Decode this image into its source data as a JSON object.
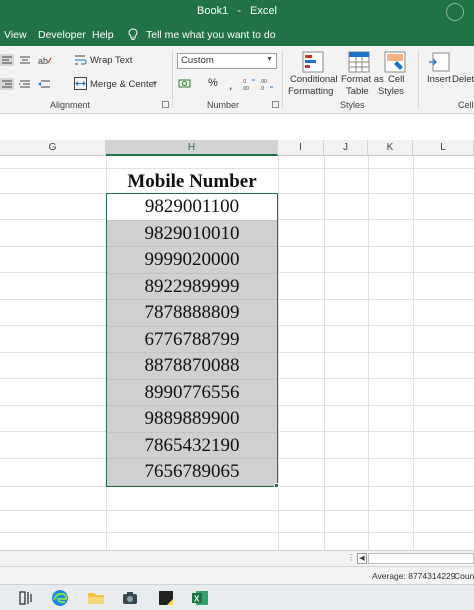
{
  "window": {
    "workbook": "Book1",
    "separator": "-",
    "app": "Excel"
  },
  "ribbon_tabs": {
    "view": "View",
    "developer": "Developer",
    "help": "Help",
    "tell_me": "Tell me what you want to do"
  },
  "ribbon": {
    "alignment": {
      "wrap_text": "Wrap Text",
      "merge_center": "Merge & Center",
      "label": "Alignment"
    },
    "number": {
      "format_value": "Custom",
      "percent": "%",
      "label": "Number"
    },
    "styles": {
      "conditional_line1": "Conditional",
      "conditional_line2": "Formatting",
      "format_table_line1": "Format as",
      "format_table_line2": "Table",
      "cell_styles_line1": "Cell",
      "cell_styles_line2": "Styles",
      "label": "Styles"
    },
    "cells": {
      "insert": "Insert",
      "delete": "Delete",
      "label": "Cells"
    }
  },
  "columns": [
    "G",
    "H",
    "I",
    "J",
    "K",
    "L"
  ],
  "sheet": {
    "header": "Mobile Number",
    "active_cell_value": "9829001100",
    "values": [
      "9829010010",
      "9999020000",
      "8922989999",
      "7878888809",
      "6776788799",
      "8878870088",
      "8990776556",
      "9889889900",
      "7865432190",
      "7656789065"
    ]
  },
  "status": {
    "average": "Average: 8774314229",
    "count": "Count"
  },
  "colors": {
    "brand": "#217346",
    "selection_fill": "#d0d0d0"
  }
}
